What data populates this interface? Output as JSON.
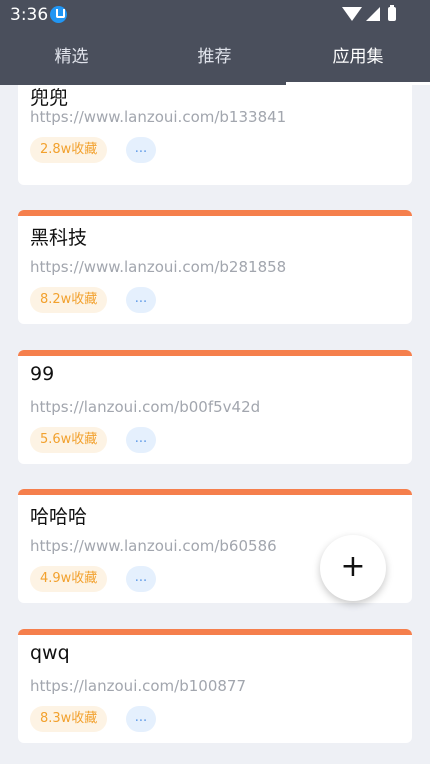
{
  "status": {
    "time": "3:36"
  },
  "tabs": [
    {
      "label": "精选"
    },
    {
      "label": "推荐"
    },
    {
      "label": "应用集"
    }
  ],
  "cards": [
    {
      "title": "兜兜",
      "url": "https://www.lanzoui.com/b133841",
      "favorites": "2.8w收藏",
      "more": "..."
    },
    {
      "title": "黑科技",
      "url": "https://www.lanzoui.com/b281858",
      "favorites": "8.2w收藏",
      "more": "..."
    },
    {
      "title": "99",
      "url": "https://lanzoui.com/b00f5v42d",
      "favorites": "5.6w收藏",
      "more": "..."
    },
    {
      "title": "哈哈哈",
      "url": "https://www.lanzoui.com/b60586",
      "favorites": "4.9w收藏",
      "more": "..."
    },
    {
      "title": "qwq",
      "url": "https://lanzoui.com/b100877",
      "favorites": "8.3w收藏",
      "more": "..."
    }
  ],
  "fab": {
    "label": "+"
  },
  "icons": {
    "download": "download-notification-icon",
    "wifi": "wifi-icon",
    "signal": "cell-signal-icon",
    "battery": "battery-icon",
    "add": "plus-icon"
  },
  "colors": {
    "header": "#4a4f5c",
    "card_accent": "#f57f4c",
    "fav_text": "#f2a12e",
    "more_text": "#5a97e6"
  }
}
